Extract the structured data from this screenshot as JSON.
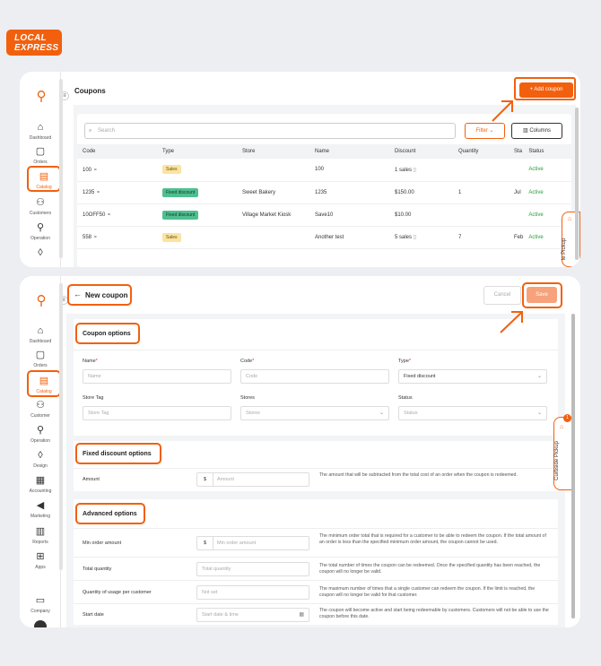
{
  "brand": {
    "logo_line1": "LOCAL",
    "logo_line2": "EXPRESS",
    "accent": "#f2600e"
  },
  "sidebar_top": {
    "items": [
      {
        "label": "Dashboard",
        "icon": "home-icon"
      },
      {
        "label": "Orders",
        "icon": "bag-icon"
      },
      {
        "label": "Catalog",
        "icon": "clipboard-icon",
        "selected": true
      },
      {
        "label": "Customers",
        "icon": "users-icon"
      },
      {
        "label": "Operation",
        "icon": "network-icon"
      }
    ]
  },
  "coupons": {
    "title": "Coupons",
    "add_button": "+ Add coupon",
    "search_placeholder": "Search",
    "filter_label": "Filter",
    "columns_label": "Columns",
    "headers": [
      "Code",
      "Type",
      "Store",
      "Name",
      "Discount",
      "Quantity",
      "Sta",
      "Status"
    ],
    "rows": [
      {
        "code": "100",
        "type": "Sales",
        "store": "",
        "name": "100",
        "discount": "1 sales",
        "quantity": "",
        "sta": "",
        "status": "Active"
      },
      {
        "code": "1235",
        "type": "Fixed discount",
        "store": "Sweet Bakery",
        "name": "1235",
        "discount": "$150.00",
        "quantity": "1",
        "sta": "Jul",
        "status": "Active"
      },
      {
        "code": "10OFF50",
        "type": "Fixed discount",
        "store": "Village Market Kiosk",
        "name": "Save10",
        "discount": "$10.00",
        "quantity": "",
        "sta": "",
        "status": "Active"
      },
      {
        "code": "558",
        "type": "Sales",
        "store": "",
        "name": "Another test",
        "discount": "5 sales",
        "quantity": "7",
        "sta": "Feb",
        "status": "Active"
      }
    ],
    "curbside_partial": "le Pickup"
  },
  "sidebar_bottom": {
    "items": [
      {
        "label": "Dashboard",
        "icon": "home-icon"
      },
      {
        "label": "Orders",
        "icon": "bag-icon"
      },
      {
        "label": "Catalog",
        "icon": "clipboard-icon",
        "selected": true
      },
      {
        "label": "Customer",
        "icon": "users-icon"
      },
      {
        "label": "Operation",
        "icon": "network-icon"
      },
      {
        "label": "Design",
        "icon": "palette-icon"
      },
      {
        "label": "Accounting",
        "icon": "calculator-icon"
      },
      {
        "label": "Marketing",
        "icon": "megaphone-icon"
      },
      {
        "label": "Reports",
        "icon": "bar-chart-icon"
      },
      {
        "label": "Apps",
        "icon": "grid-icon"
      },
      {
        "label": "Company",
        "icon": "building-icon"
      }
    ]
  },
  "new_coupon": {
    "title": "New coupon",
    "cancel": "Cancel",
    "save": "Save",
    "coupon_options_title": "Coupon options",
    "fields": {
      "name_label": "Name",
      "name_placeholder": "Name",
      "code_label": "Code",
      "code_placeholder": "Code",
      "type_label": "Type",
      "type_value": "Fixed discount",
      "store_tag_label": "Store Tag",
      "store_tag_placeholder": "Store Tag",
      "stores_label": "Stores",
      "stores_placeholder": "Stores",
      "status_label": "Status",
      "status_placeholder": "Status"
    },
    "fixed_title": "Fixed discount options",
    "amount_label": "Amount",
    "amount_currency": "$",
    "amount_placeholder": "Amount",
    "amount_help": "The amount that will be subtracted from the total cost of an order when the coupon is redeemed.",
    "advanced_title": "Advanced options",
    "min_order_label": "Min order amount",
    "min_order_currency": "$",
    "min_order_placeholder": "Min order amount",
    "min_order_help": "The minimum order total that is required for a customer to be able to redeem the coupon. If the total amount of an order is less than the specified minimum order amount, the coupon cannot be used.",
    "total_qty_label": "Total quantity",
    "total_qty_placeholder": "Total quantity",
    "total_qty_help": "The total number of times the coupon can be redeemed. Once the specified quantity has been reached, the coupon will no longer be valid.",
    "per_customer_label": "Quantity of usage per customer",
    "per_customer_placeholder": "Not set",
    "per_customer_help": "The maximum number of times that a single customer can redeem the coupon. If the limit is reached, the coupon will no longer be valid for that customer.",
    "start_date_label": "Start date",
    "start_date_placeholder": "Start date & time",
    "start_date_help": "The coupon will become active and start being redeemable by customers. Customers will not be able to use the coupon before this date.",
    "curbside_label": "Curbside Pickup",
    "curbside_badge": "1"
  }
}
